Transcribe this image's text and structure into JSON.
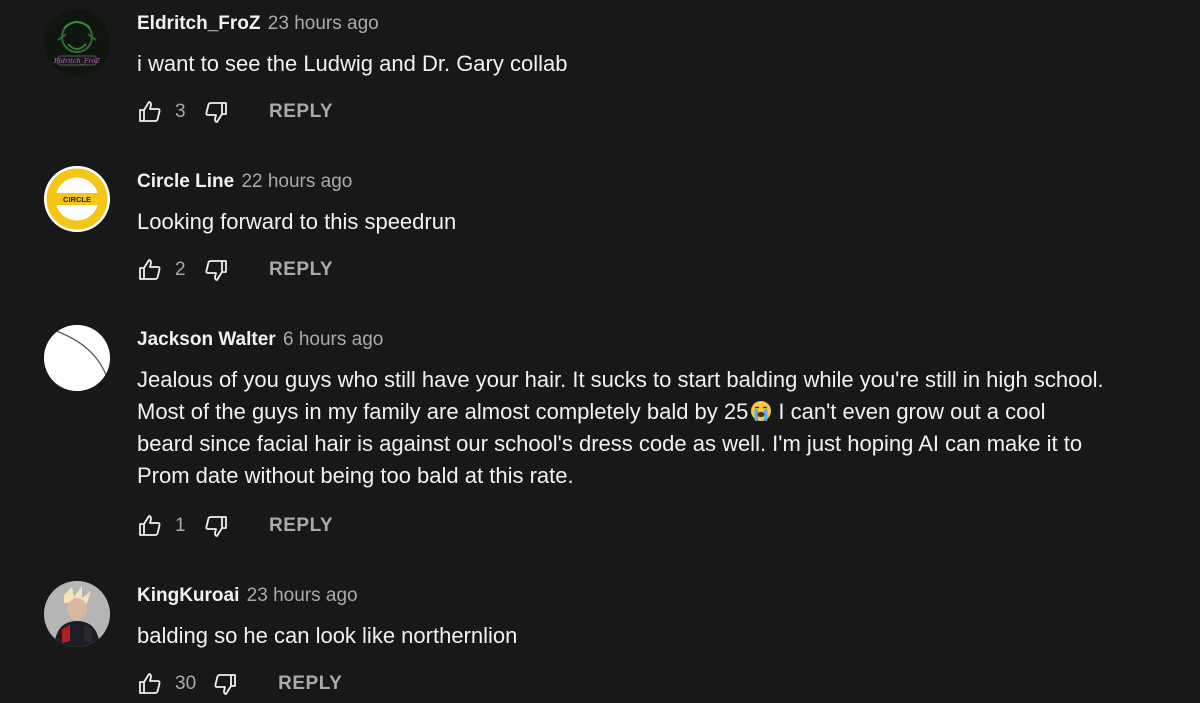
{
  "comments": [
    {
      "author": "Eldritch_FroZ",
      "time": "23 hours ago",
      "text": "i want to see the Ludwig and Dr. Gary collab",
      "likes": "3",
      "reply_label": "REPLY",
      "avatar_text": "Eldritch_FroZ"
    },
    {
      "author": "Circle Line",
      "time": "22 hours ago",
      "text": "Looking forward to this speedrun",
      "likes": "2",
      "reply_label": "REPLY",
      "avatar_text": "CIRCLE"
    },
    {
      "author": "Jackson Walter",
      "time": "6 hours ago",
      "text_lines": [
        "Jealous of you guys who still have your hair. It sucks to start balding while you're still in high school.",
        "Most of the guys in my family are almost completely bald by 25",
        "I can't even grow out a cool",
        "beard since facial hair is against our school's dress code as well. I'm just hoping AI can make it to",
        "Prom date without being too bald at this rate."
      ],
      "likes": "1",
      "reply_label": "REPLY"
    },
    {
      "author": "KingKuroai",
      "time": "23 hours ago",
      "text": "balding so he can look like northernlion",
      "likes": "30",
      "reply_label": "REPLY"
    }
  ],
  "colors": {
    "background": "#181818",
    "text_primary": "#f1f1f1",
    "text_secondary": "#aaaaaa",
    "circle_yellow": "#f5c518"
  },
  "icons": {
    "like": "thumbs-up-icon",
    "dislike": "thumbs-down-icon",
    "emoji": "loudly-crying-face-emoji"
  }
}
